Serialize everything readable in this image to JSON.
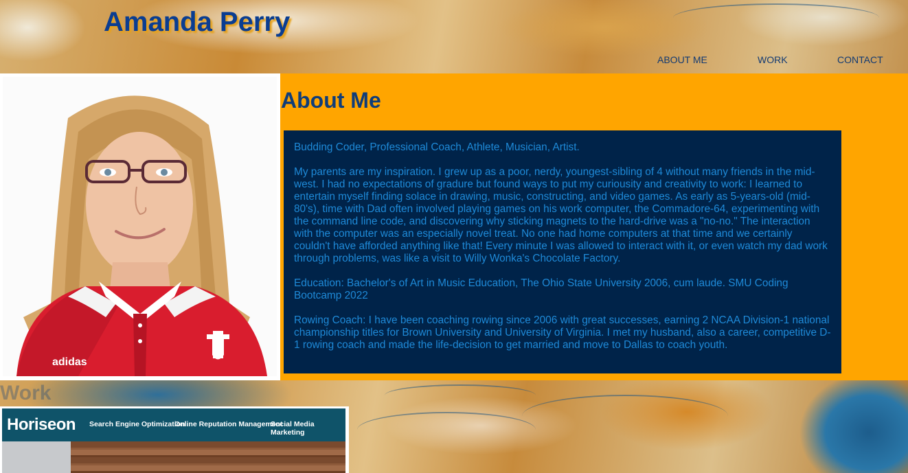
{
  "header": {
    "title": "Amanda Perry",
    "nav": [
      {
        "label": "ABOUT ME"
      },
      {
        "label": "WORK"
      },
      {
        "label": "CONTACT"
      }
    ]
  },
  "about": {
    "heading": "About Me",
    "paragraphs": [
      "Budding Coder, Professional Coach, Athlete, Musician, Artist.",
      "My parents are my inspiration. I grew up as a poor, nerdy, youngest-sibling of 4 without many friends in the mid-west. I had no expectations of gradure but found ways to put my curiousity and creativity to work: I learned to entertain myself finding solace in drawing, music, constructing, and video games. As early as 5-years-old (mid-80's), time with Dad often involved playing games on his work computer, the Commadore-64, experimenting with the command line code, and discovering why sticking magnets to the hard-drive was a \"no-no.\" The interaction with the computer was an especially novel treat. No one had home computers at that time and we certainly couldn't have afforded anything like that! Every minute I was allowed to interact with it, or even watch my dad work through problems, was like a visit to Willy Wonka's Chocolate Factory.",
      "Education: Bachelor's of Art in Music Education, The Ohio State University 2006, cum laude. SMU Coding Bootcamp 2022",
      "Rowing Coach: I have been coaching rowing since 2006 with great successes, earning 2 NCAA Division-1 national championship titles for Brown University and University of Virginia. I met my husband, also a career, competitive D-1 rowing coach and made the life-decision to get married and move to Dallas to coach youth."
    ]
  },
  "work": {
    "section_label": "Work",
    "project": {
      "logo": "Horiseon",
      "nav": [
        "Search Engine Optimization",
        "Online Reputation Management",
        "Social Media Marketing"
      ]
    }
  },
  "colors": {
    "title": "#0a3d91",
    "accent_orange": "#ffa500",
    "box_navy": "#002349",
    "box_text": "#1e8ad8"
  }
}
